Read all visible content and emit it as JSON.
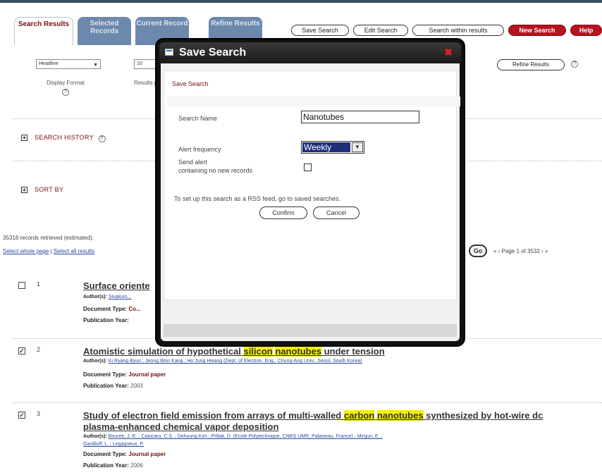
{
  "tabs": [
    {
      "label": "Search Results",
      "active": true
    },
    {
      "label": "Selected Records",
      "active": false
    },
    {
      "label": "Current Record",
      "active": false
    },
    {
      "label": "Refine Results",
      "active": false
    }
  ],
  "actions": {
    "save_search": "Save Search",
    "edit_search": "Edit Search",
    "search_within": "Search within results",
    "new_search": "New Search",
    "help": "Help"
  },
  "options": {
    "display_format_value": "Headline",
    "display_format_label": "Display Format",
    "results_per_page_value": "10",
    "results_per_page_label": "Results per page",
    "refine_results": "Refine Results",
    "help_glyph": "?"
  },
  "sections": {
    "search_history": "SEARCH HISTORY",
    "sort_by": "SORT BY",
    "expand_glyph": "+"
  },
  "records": {
    "info": "35318 records retrieved (estimated).",
    "select_whole_page": "Select whole page",
    "separator": " | ",
    "select_all": "Select all results",
    "go": "Go",
    "pager": "« ‹ Page 1 of 3532 › »"
  },
  "results": [
    {
      "num": "1",
      "checked": false,
      "title_parts": [
        "Surface oriente"
      ],
      "authors_label": "Author(s):",
      "authors": "Sivakum...",
      "doc_type_label": "Document Type:",
      "doc_type": "Co...",
      "year_label": "Publication Year:",
      "year": ""
    },
    {
      "num": "2",
      "checked": true,
      "title_pre": "Atomistic simulation of hypothetical ",
      "title_hl1": "silicon",
      "title_mid": " ",
      "title_hl2": "nanotubes",
      "title_post": " under tension",
      "authors_label": "Author(s):",
      "authors": "Ki Ryang Byun ; Jeong Won Kang ; Ho Jung Hwang (Dept. of Electron. Eng., Chung-Ang Univ., Seoul, South Korea)",
      "doc_type_label": "Document Type:",
      "doc_type": "Journal paper",
      "year_label": "Publication Year:",
      "year": "2003"
    },
    {
      "num": "3",
      "checked": true,
      "title_pre": "Study of electron field emission from arrays of multi-walled ",
      "title_hl1": "carbon",
      "title_mid": " ",
      "title_hl2": "nanotubes",
      "title_post": " synthesized by hot-wire dc",
      "title_line2": "plasma-enhanced chemical vapor deposition",
      "authors_label": "Author(s):",
      "authors": "Bouree, J.-E. ; Cojocaru, C.S. ; Dohyung Kim ; Pribat, D. (Ecole Polytechnique, CNRS UMR, Palaiseau, France) ; Mirgun, E. ;",
      "authors2": "Gardiloff, L. ; Legagneux, P.",
      "doc_type_label": "Document Type:",
      "doc_type": "Journal paper",
      "year_label": "Publication Year:",
      "year": "2006"
    }
  ],
  "modal": {
    "title": "Save Search",
    "close_glyph": "✖",
    "subtitle": "Save Search",
    "search_name_label": "Search Name",
    "search_name_value": "Nanotubes",
    "alert_frequency_label": "Alert frequency",
    "alert_frequency_value": "Weekly",
    "send_alert_label_line1": "Send alert",
    "send_alert_label_line2": "containing no new records",
    "rss_note": "To set up this search as a RSS feed, go to saved searches.",
    "confirm": "Confirm",
    "cancel": "Cancel"
  },
  "colors": {
    "accent_red": "#b8121f",
    "tab_blue": "#6d88ad",
    "highlight_yellow": "#f3f000",
    "select_highlight": "#1e2e78"
  }
}
